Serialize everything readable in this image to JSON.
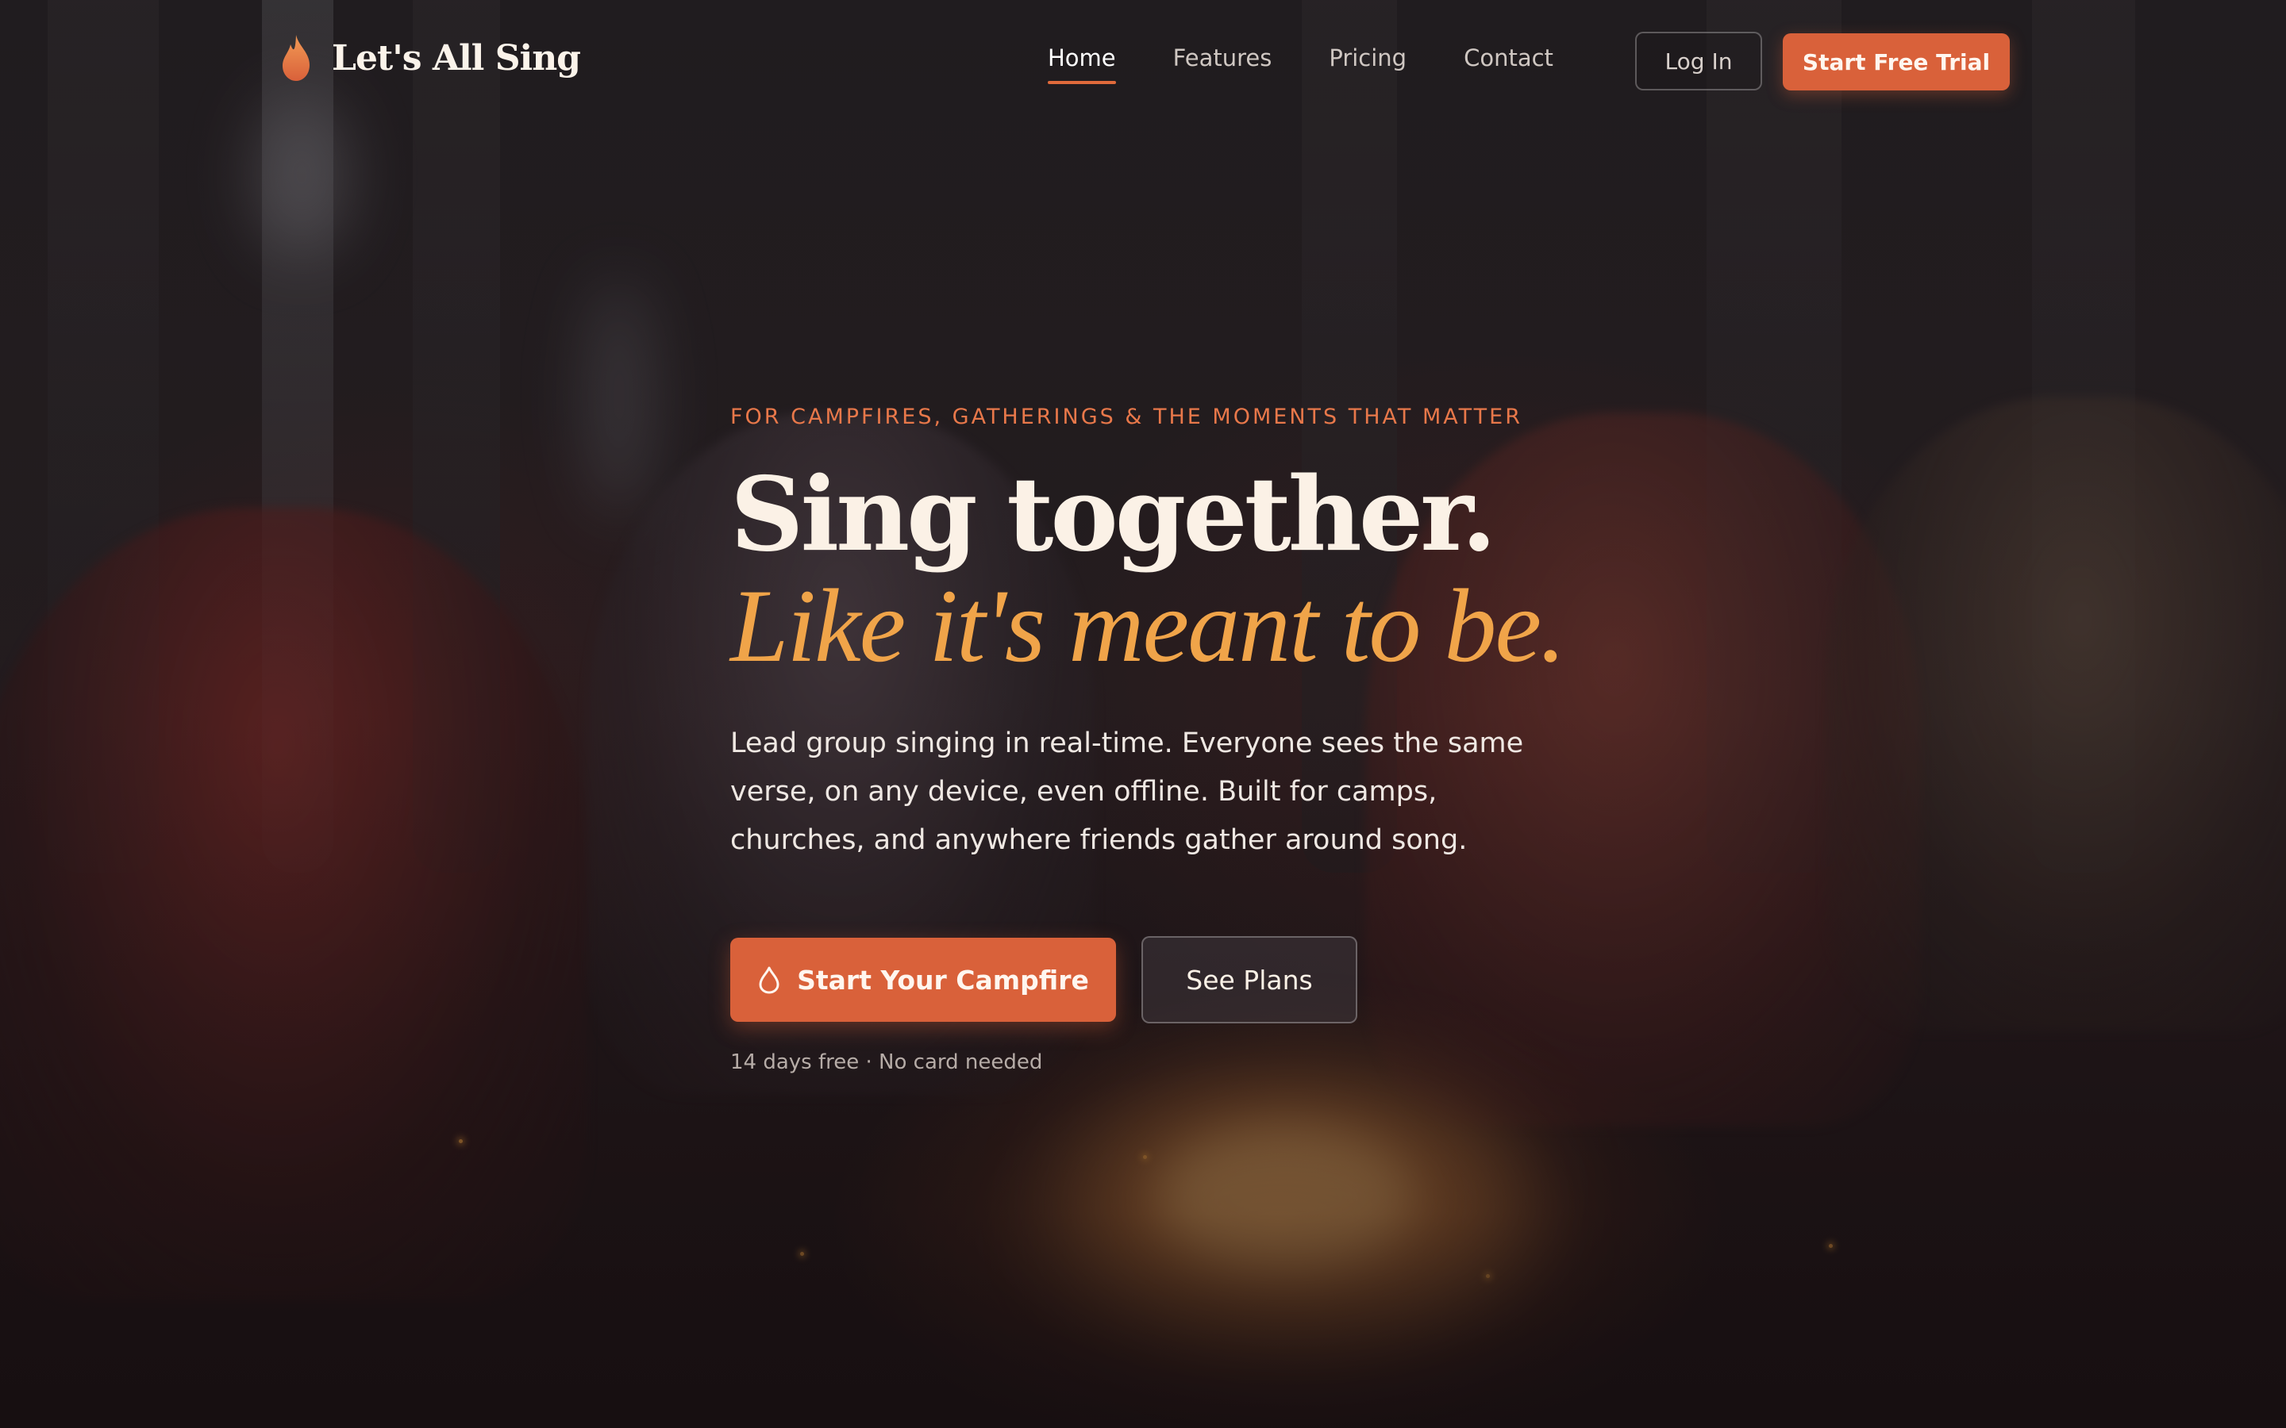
{
  "brand": {
    "name": "Let's All Sing",
    "logo_icon": "flame-icon",
    "accent": "#d9613a",
    "highlight": "#f0a449"
  },
  "nav": {
    "links": [
      {
        "label": "Home",
        "active": true
      },
      {
        "label": "Features",
        "active": false
      },
      {
        "label": "Pricing",
        "active": false
      },
      {
        "label": "Contact",
        "active": false
      }
    ],
    "login_label": "Log In",
    "trial_label": "Start Free Trial"
  },
  "hero": {
    "eyebrow": "FOR CAMPFIRES, GATHERINGS & THE MOMENTS THAT MATTER",
    "title_line1": "Sing together.",
    "title_line2": "Like it's meant to be.",
    "description": "Lead group singing in real-time. Everyone sees the same verse, on any device, even offline. Built for camps, churches, and anywhere friends gather around song.",
    "primary_cta": "Start Your Campfire",
    "primary_cta_icon": "drop-icon",
    "secondary_cta": "See Plans",
    "fine_print": "14 days free · No card needed"
  }
}
